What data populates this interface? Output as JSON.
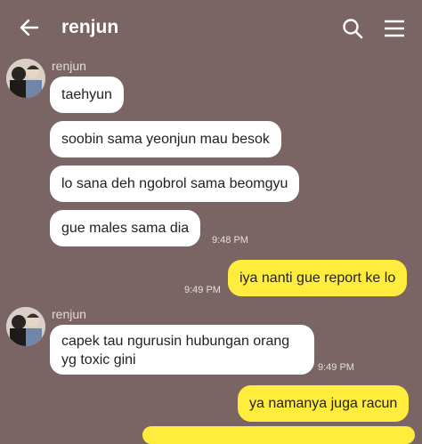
{
  "header": {
    "title": "renjun",
    "back_icon": "arrow-left-icon",
    "search_icon": "search-icon",
    "menu_icon": "hamburger-menu-icon"
  },
  "colors": {
    "background": "#7a6464",
    "incoming_bubble": "#ffffff",
    "outgoing_bubble": "#ffec3d"
  },
  "messages": [
    {
      "group": 1,
      "sender": "renjun",
      "text": "taehyun"
    },
    {
      "group": 1,
      "text": "soobin sama yeonjun mau besok"
    },
    {
      "group": 1,
      "text": "lo sana deh ngobrol sama beomgyu"
    },
    {
      "group": 1,
      "text": "gue males sama dia",
      "time": "9:48 PM"
    },
    {
      "group": 2,
      "outgoing": true,
      "text": "iya nanti gue report ke lo",
      "time": "9:49 PM"
    },
    {
      "group": 3,
      "sender": "renjun",
      "text": "capek tau ngurusin hubungan orang yg toxic gini",
      "time": "9:49 PM"
    },
    {
      "group": 4,
      "outgoing": true,
      "text": "ya namanya juga racun"
    }
  ]
}
